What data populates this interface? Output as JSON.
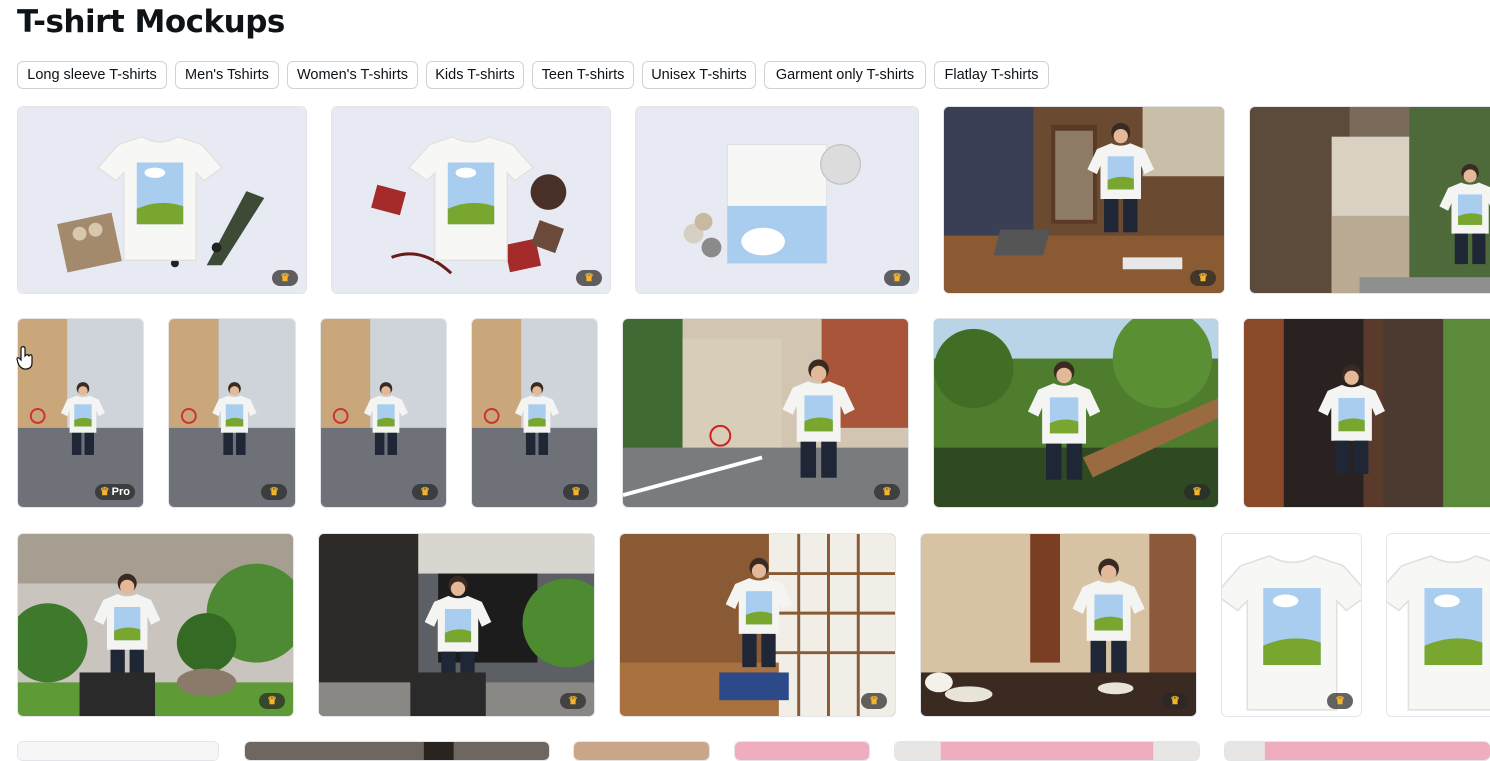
{
  "page": {
    "title": "T-shirt Mockups"
  },
  "chips": [
    "Long sleeve T-shirts",
    "Men's Tshirts",
    "Women's T-shirts",
    "Kids T-shirts",
    "Teen T-shirts",
    "Unisex T-shirts",
    "Garment only T-shirts",
    "Flatlay T-shirts"
  ],
  "badge": {
    "pro_label": "Pro",
    "crown_icon": "crown-icon"
  },
  "colors": {
    "sky": "#a9cdee",
    "grass": "#79a62f",
    "chip_border": "#cfd3d8",
    "badge_bg": "#2b2b2b",
    "crown": "#f5b52a"
  }
}
